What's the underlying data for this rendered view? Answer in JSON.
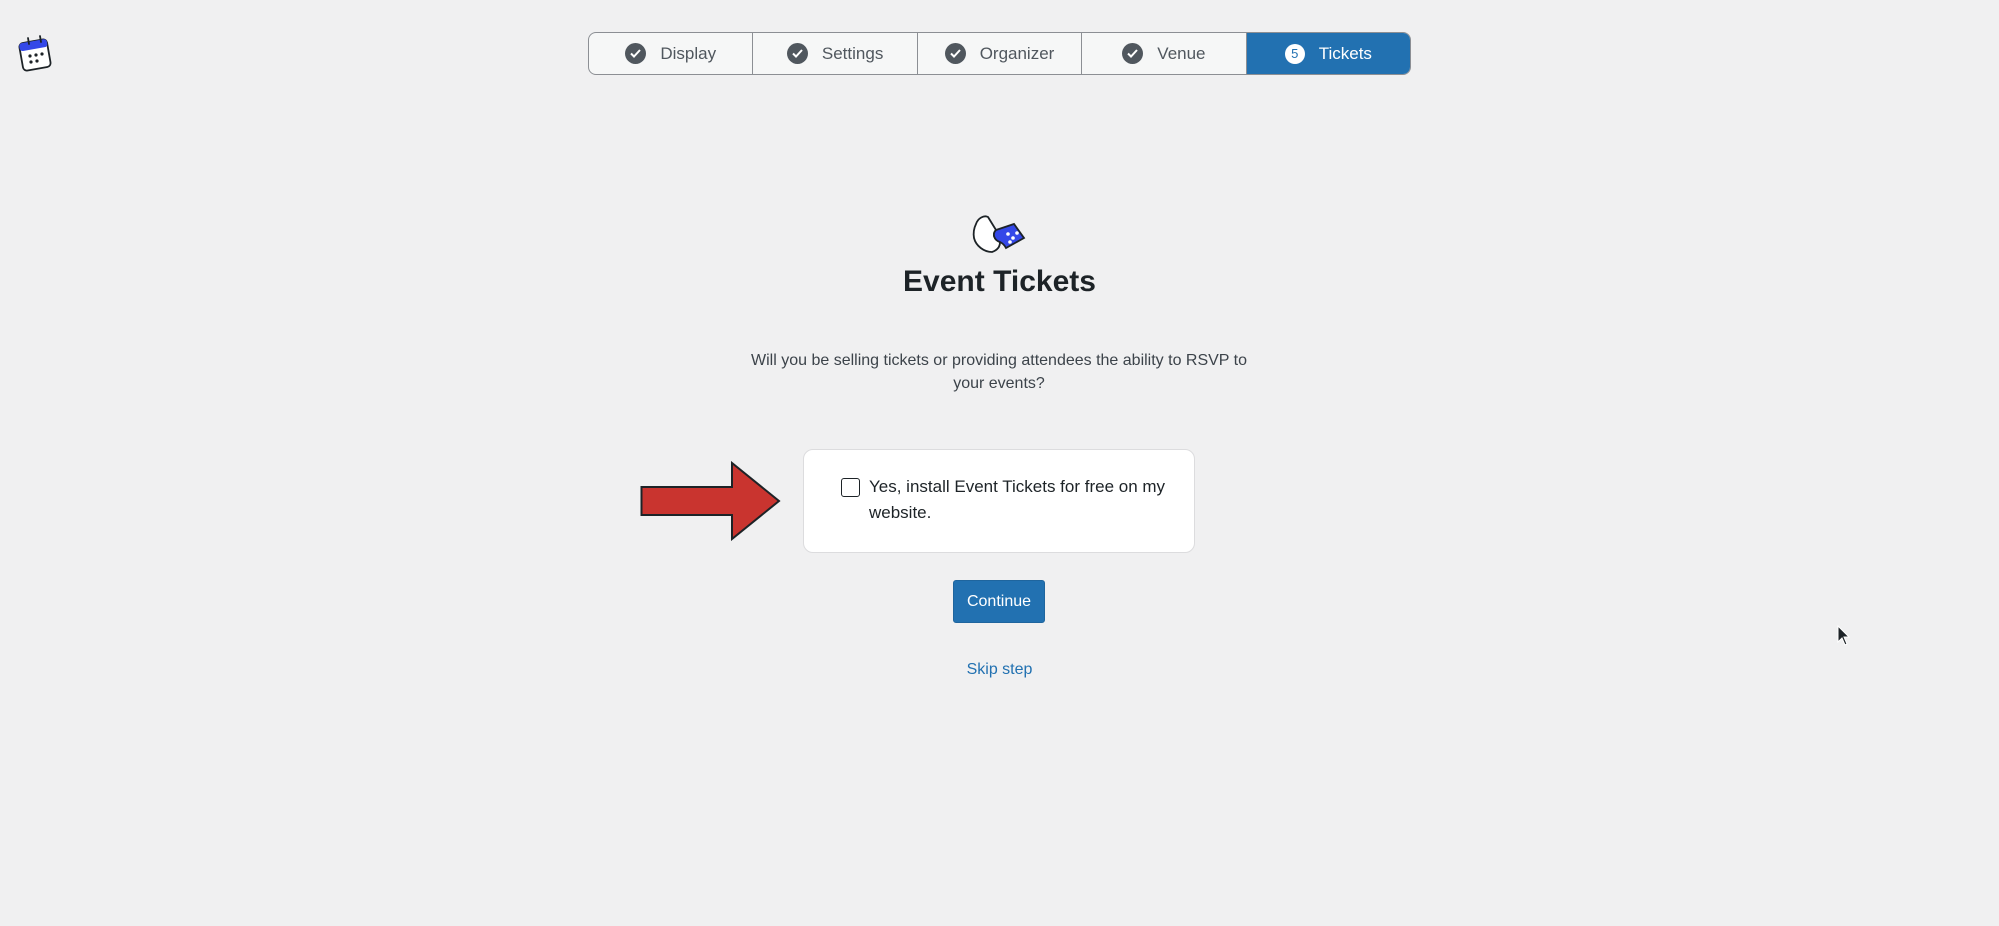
{
  "header": {
    "logo_icon": "calendar-logo-icon"
  },
  "stepper": {
    "steps": [
      {
        "label": "Display",
        "state": "completed",
        "icon": "check-icon"
      },
      {
        "label": "Settings",
        "state": "completed",
        "icon": "check-icon"
      },
      {
        "label": "Organizer",
        "state": "completed",
        "icon": "check-icon"
      },
      {
        "label": "Venue",
        "state": "completed",
        "icon": "check-icon"
      },
      {
        "label": "Tickets",
        "state": "active",
        "number": "5"
      }
    ],
    "active_color": "#2271b1"
  },
  "main": {
    "hero_icon": "ticket-icon",
    "title": "Event Tickets",
    "description": "Will you be selling tickets or providing attendees the ability to RSVP to your events?",
    "option": {
      "checked": false,
      "label": "Yes, install Event Tickets for free on my website."
    },
    "continue_label": "Continue",
    "skip_label": "Skip step"
  },
  "annotation": {
    "arrow_icon": "red-arrow-icon",
    "arrow_color": "#c9342f"
  }
}
